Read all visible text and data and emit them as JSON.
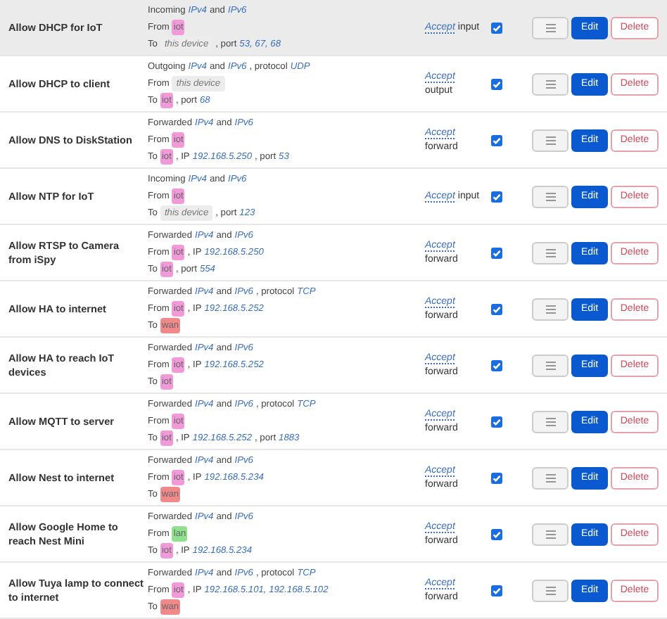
{
  "rules": [
    {
      "name": "Allow DHCP for IoT",
      "highlighted": true,
      "lines": [
        [
          {
            "kind": "text",
            "text": "Incoming"
          },
          {
            "kind": "link",
            "text": "IPv4"
          },
          {
            "kind": "text",
            "text": "and"
          },
          {
            "kind": "link",
            "text": "IPv6"
          }
        ],
        [
          {
            "kind": "text",
            "text": "From"
          },
          {
            "kind": "zone",
            "text": "iot",
            "color": "#f09ad8"
          }
        ],
        [
          {
            "kind": "text",
            "text": "To"
          },
          {
            "kind": "device",
            "text": "this device"
          },
          {
            "kind": "text",
            "text": ", port"
          },
          {
            "kind": "link",
            "text": "53, 67, 68"
          }
        ]
      ],
      "action": "Accept",
      "chain": "input",
      "enabled": true,
      "buttons": {
        "edit": "Edit",
        "delete": "Delete"
      }
    },
    {
      "name": "Allow DHCP to client",
      "highlighted": false,
      "lines": [
        [
          {
            "kind": "text",
            "text": "Outgoing"
          },
          {
            "kind": "link",
            "text": "IPv4"
          },
          {
            "kind": "text",
            "text": "and"
          },
          {
            "kind": "link",
            "text": "IPv6"
          },
          {
            "kind": "text",
            "text": ", protocol"
          },
          {
            "kind": "link",
            "text": "UDP"
          }
        ],
        [
          {
            "kind": "text",
            "text": "From"
          },
          {
            "kind": "device",
            "text": "this device"
          }
        ],
        [
          {
            "kind": "text",
            "text": "To"
          },
          {
            "kind": "zone",
            "text": "iot",
            "color": "#f09ad8"
          },
          {
            "kind": "text",
            "text": ", port"
          },
          {
            "kind": "link",
            "text": "68"
          }
        ]
      ],
      "action": "Accept",
      "chain": "output",
      "enabled": true,
      "buttons": {
        "edit": "Edit",
        "delete": "Delete"
      }
    },
    {
      "name": "Allow DNS to DiskStation",
      "highlighted": false,
      "lines": [
        [
          {
            "kind": "text",
            "text": "Forwarded"
          },
          {
            "kind": "link",
            "text": "IPv4"
          },
          {
            "kind": "text",
            "text": "and"
          },
          {
            "kind": "link",
            "text": "IPv6"
          }
        ],
        [
          {
            "kind": "text",
            "text": "From"
          },
          {
            "kind": "zone",
            "text": "iot",
            "color": "#f09ad8"
          }
        ],
        [
          {
            "kind": "text",
            "text": "To"
          },
          {
            "kind": "zone",
            "text": "iot",
            "color": "#f09ad8"
          },
          {
            "kind": "text",
            "text": ", IP"
          },
          {
            "kind": "link",
            "text": "192.168.5.250"
          },
          {
            "kind": "text",
            "text": ", port"
          },
          {
            "kind": "link",
            "text": "53"
          }
        ]
      ],
      "action": "Accept",
      "chain": "forward",
      "enabled": true,
      "buttons": {
        "edit": "Edit",
        "delete": "Delete"
      }
    },
    {
      "name": "Allow NTP for IoT",
      "highlighted": false,
      "lines": [
        [
          {
            "kind": "text",
            "text": "Incoming"
          },
          {
            "kind": "link",
            "text": "IPv4"
          },
          {
            "kind": "text",
            "text": "and"
          },
          {
            "kind": "link",
            "text": "IPv6"
          }
        ],
        [
          {
            "kind": "text",
            "text": "From"
          },
          {
            "kind": "zone",
            "text": "iot",
            "color": "#f09ad8"
          }
        ],
        [
          {
            "kind": "text",
            "text": "To"
          },
          {
            "kind": "device",
            "text": "this device"
          },
          {
            "kind": "text",
            "text": ", port"
          },
          {
            "kind": "link",
            "text": "123"
          }
        ]
      ],
      "action": "Accept",
      "chain": "input",
      "enabled": true,
      "buttons": {
        "edit": "Edit",
        "delete": "Delete"
      }
    },
    {
      "name": "Allow RTSP to Camera from iSpy",
      "highlighted": false,
      "lines": [
        [
          {
            "kind": "text",
            "text": "Forwarded"
          },
          {
            "kind": "link",
            "text": "IPv4"
          },
          {
            "kind": "text",
            "text": "and"
          },
          {
            "kind": "link",
            "text": "IPv6"
          }
        ],
        [
          {
            "kind": "text",
            "text": "From"
          },
          {
            "kind": "zone",
            "text": "iot",
            "color": "#f09ad8"
          },
          {
            "kind": "text",
            "text": ", IP"
          },
          {
            "kind": "link",
            "text": "192.168.5.250"
          }
        ],
        [
          {
            "kind": "text",
            "text": "To"
          },
          {
            "kind": "zone",
            "text": "iot",
            "color": "#f09ad8"
          },
          {
            "kind": "text",
            "text": ", port"
          },
          {
            "kind": "link",
            "text": "554"
          }
        ]
      ],
      "action": "Accept",
      "chain": "forward",
      "enabled": true,
      "buttons": {
        "edit": "Edit",
        "delete": "Delete"
      }
    },
    {
      "name": "Allow HA to internet",
      "highlighted": false,
      "lines": [
        [
          {
            "kind": "text",
            "text": "Forwarded"
          },
          {
            "kind": "link",
            "text": "IPv4"
          },
          {
            "kind": "text",
            "text": "and"
          },
          {
            "kind": "link",
            "text": "IPv6"
          },
          {
            "kind": "text",
            "text": ", protocol"
          },
          {
            "kind": "link",
            "text": "TCP"
          }
        ],
        [
          {
            "kind": "text",
            "text": "From"
          },
          {
            "kind": "zone",
            "text": "iot",
            "color": "#f09ad8"
          },
          {
            "kind": "text",
            "text": ", IP"
          },
          {
            "kind": "link",
            "text": "192.168.5.252"
          }
        ],
        [
          {
            "kind": "text",
            "text": "To"
          },
          {
            "kind": "zone",
            "text": "wan",
            "color": "#f08a8a"
          }
        ]
      ],
      "action": "Accept",
      "chain": "forward",
      "enabled": true,
      "buttons": {
        "edit": "Edit",
        "delete": "Delete"
      }
    },
    {
      "name": "Allow HA to reach IoT devices",
      "highlighted": false,
      "lines": [
        [
          {
            "kind": "text",
            "text": "Forwarded"
          },
          {
            "kind": "link",
            "text": "IPv4"
          },
          {
            "kind": "text",
            "text": "and"
          },
          {
            "kind": "link",
            "text": "IPv6"
          }
        ],
        [
          {
            "kind": "text",
            "text": "From"
          },
          {
            "kind": "zone",
            "text": "iot",
            "color": "#f09ad8"
          },
          {
            "kind": "text",
            "text": ", IP"
          },
          {
            "kind": "link",
            "text": "192.168.5.252"
          }
        ],
        [
          {
            "kind": "text",
            "text": "To"
          },
          {
            "kind": "zone",
            "text": "iot",
            "color": "#f09ad8"
          }
        ]
      ],
      "action": "Accept",
      "chain": "forward",
      "enabled": true,
      "buttons": {
        "edit": "Edit",
        "delete": "Delete"
      }
    },
    {
      "name": "Allow MQTT to server",
      "highlighted": false,
      "lines": [
        [
          {
            "kind": "text",
            "text": "Forwarded"
          },
          {
            "kind": "link",
            "text": "IPv4"
          },
          {
            "kind": "text",
            "text": "and"
          },
          {
            "kind": "link",
            "text": "IPv6"
          },
          {
            "kind": "text",
            "text": ", protocol"
          },
          {
            "kind": "link",
            "text": "TCP"
          }
        ],
        [
          {
            "kind": "text",
            "text": "From"
          },
          {
            "kind": "zone",
            "text": "iot",
            "color": "#f09ad8"
          }
        ],
        [
          {
            "kind": "text",
            "text": "To"
          },
          {
            "kind": "zone",
            "text": "iot",
            "color": "#f09ad8"
          },
          {
            "kind": "text",
            "text": ", IP"
          },
          {
            "kind": "link",
            "text": "192.168.5.252"
          },
          {
            "kind": "text",
            "text": ", port"
          },
          {
            "kind": "link",
            "text": "1883"
          }
        ]
      ],
      "action": "Accept",
      "chain": "forward",
      "enabled": true,
      "buttons": {
        "edit": "Edit",
        "delete": "Delete"
      }
    },
    {
      "name": "Allow Nest to internet",
      "highlighted": false,
      "lines": [
        [
          {
            "kind": "text",
            "text": "Forwarded"
          },
          {
            "kind": "link",
            "text": "IPv4"
          },
          {
            "kind": "text",
            "text": "and"
          },
          {
            "kind": "link",
            "text": "IPv6"
          }
        ],
        [
          {
            "kind": "text",
            "text": "From"
          },
          {
            "kind": "zone",
            "text": "iot",
            "color": "#f09ad8"
          },
          {
            "kind": "text",
            "text": ", IP"
          },
          {
            "kind": "link",
            "text": "192.168.5.234"
          }
        ],
        [
          {
            "kind": "text",
            "text": "To"
          },
          {
            "kind": "zone",
            "text": "wan",
            "color": "#f08a8a"
          }
        ]
      ],
      "action": "Accept",
      "chain": "forward",
      "enabled": true,
      "buttons": {
        "edit": "Edit",
        "delete": "Delete"
      }
    },
    {
      "name": "Allow Google Home to reach Nest Mini",
      "highlighted": false,
      "lines": [
        [
          {
            "kind": "text",
            "text": "Forwarded"
          },
          {
            "kind": "link",
            "text": "IPv4"
          },
          {
            "kind": "text",
            "text": "and"
          },
          {
            "kind": "link",
            "text": "IPv6"
          }
        ],
        [
          {
            "kind": "text",
            "text": "From"
          },
          {
            "kind": "zone",
            "text": "lan",
            "color": "#90e090"
          }
        ],
        [
          {
            "kind": "text",
            "text": "To"
          },
          {
            "kind": "zone",
            "text": "iot",
            "color": "#f09ad8"
          },
          {
            "kind": "text",
            "text": ", IP"
          },
          {
            "kind": "link",
            "text": "192.168.5.234"
          }
        ]
      ],
      "action": "Accept",
      "chain": "forward",
      "enabled": true,
      "buttons": {
        "edit": "Edit",
        "delete": "Delete"
      }
    },
    {
      "name": "Allow Tuya lamp to connect to internet",
      "highlighted": false,
      "lines": [
        [
          {
            "kind": "text",
            "text": "Forwarded"
          },
          {
            "kind": "link",
            "text": "IPv4"
          },
          {
            "kind": "text",
            "text": "and"
          },
          {
            "kind": "link",
            "text": "IPv6"
          },
          {
            "kind": "text",
            "text": ", protocol"
          },
          {
            "kind": "link",
            "text": "TCP"
          }
        ],
        [
          {
            "kind": "text",
            "text": "From"
          },
          {
            "kind": "zone",
            "text": "iot",
            "color": "#f09ad8"
          },
          {
            "kind": "text",
            "text": ", IP"
          },
          {
            "kind": "link",
            "text": "192.168.5.101, 192.168.5.102"
          }
        ],
        [
          {
            "kind": "text",
            "text": "To"
          },
          {
            "kind": "zone",
            "text": "wan",
            "color": "#f08a8a"
          }
        ]
      ],
      "action": "Accept",
      "chain": "forward",
      "enabled": true,
      "buttons": {
        "edit": "Edit",
        "delete": "Delete"
      }
    }
  ]
}
